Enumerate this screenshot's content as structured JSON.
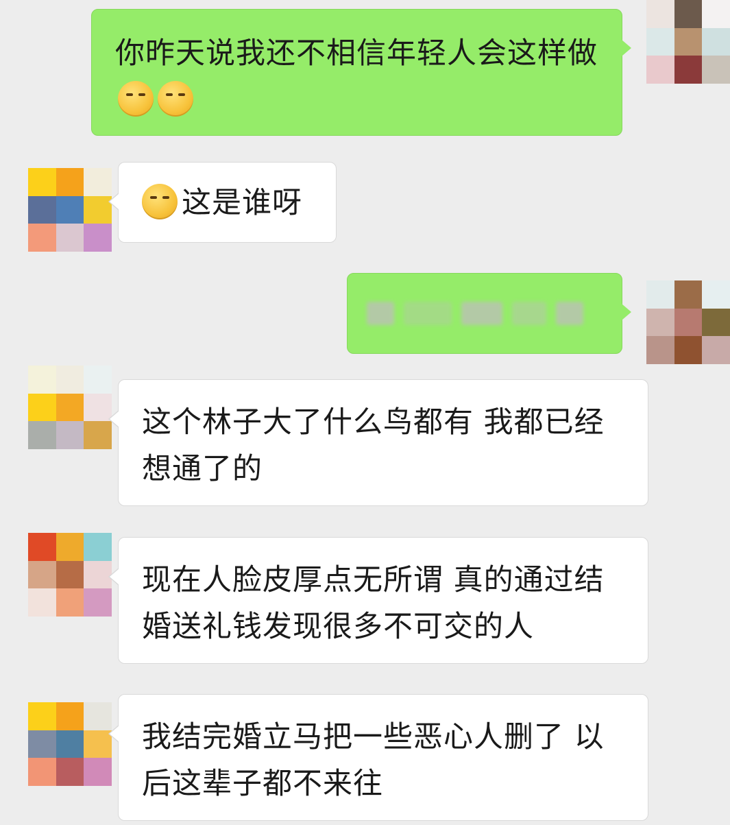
{
  "messages": [
    {
      "side": "out",
      "text": "你昨天说我还不相信年轻人会这样做",
      "emoji": [
        "shush-emoji",
        "sweat-emoji"
      ]
    },
    {
      "side": "in",
      "emoji": [
        "thinking-emoji"
      ],
      "text": "这是谁呀"
    },
    {
      "side": "out",
      "text": "",
      "blurred": true
    },
    {
      "side": "in",
      "text": "这个林子大了什么鸟都有 我都已经想通了的"
    },
    {
      "side": "in",
      "text": "现在人脸皮厚点无所谓 真的通过结婚送礼钱发现很多不可交的人"
    },
    {
      "side": "in",
      "text": "我结完婚立马把一些恶心人删了 以后这辈子都不来往"
    }
  ],
  "colors": {
    "background": "#ededed",
    "outgoing_bubble": "#95ec69",
    "incoming_bubble": "#ffffff"
  },
  "avatars": {
    "me_1": [
      "#ece4e0",
      "#6c5a4c",
      "#f4f2f2",
      "#dbe8e8",
      "#b8926f",
      "#cfe0e0",
      "#e9c9cc",
      "#8b3a3a",
      "#c9c2b8"
    ],
    "friend_1": [
      "#fcd01a",
      "#f5a21b",
      "#f2eddc",
      "#5b6f99",
      "#4f7fb6",
      "#f2cc2f",
      "#f39a7a",
      "#dbc7d0",
      "#c98fc9"
    ],
    "me_2": [
      "#e2ebeb",
      "#9b6c48",
      "#e6eff0",
      "#cfb4ae",
      "#b77a70",
      "#7d6a3a",
      "#b9948a",
      "#8f5230",
      "#c8aaa8"
    ],
    "friend_2": [
      "#f4f2db",
      "#f0ece0",
      "#eaf1f1",
      "#fcd01a",
      "#f3a824",
      "#efe1e3",
      "#aaaeaa",
      "#c4b9c4",
      "#d8a64b"
    ],
    "friend_3": [
      "#e04a26",
      "#eeaa2c",
      "#8bcfd3",
      "#d6a587",
      "#b66c46",
      "#ecd5d6",
      "#f2e2dc",
      "#f0a179",
      "#d49ac1"
    ],
    "friend_4": [
      "#fcd01a",
      "#f5a21b",
      "#e6e5de",
      "#7e8ca4",
      "#4f7fa2",
      "#f5c04e",
      "#f29575",
      "#b85d5f",
      "#d18ab8"
    ]
  }
}
